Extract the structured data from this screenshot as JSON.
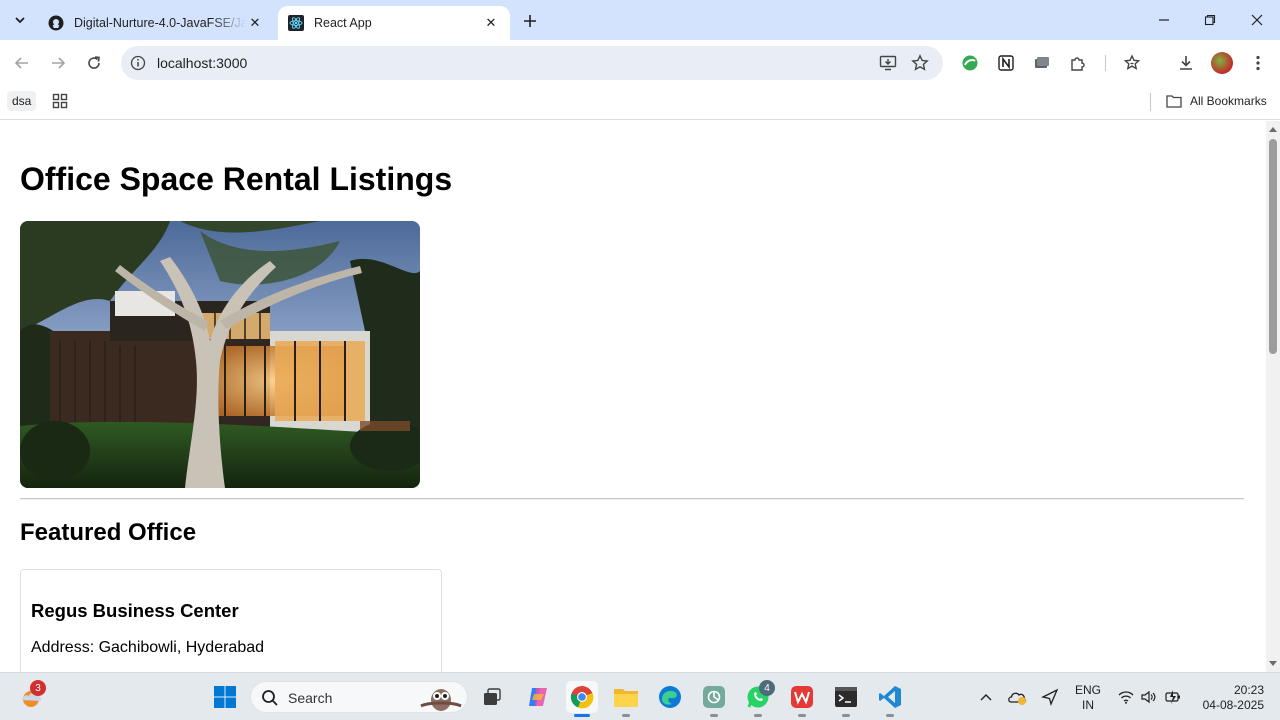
{
  "browser": {
    "tabs": [
      {
        "title": "Digital-Nurture-4.0-JavaFSE/Jav",
        "active": false
      },
      {
        "title": "React App",
        "active": true
      }
    ],
    "address": "localhost:3000",
    "bookmarks": {
      "chip_label": "dsa",
      "all_bookmarks_label": "All Bookmarks"
    }
  },
  "page": {
    "title": "Office Space Rental Listings",
    "featured_heading": "Featured Office",
    "office": {
      "name": "Regus Business Center",
      "address": "Address: Gachibowli, Hyderabad"
    }
  },
  "taskbar": {
    "weather_badge": "3",
    "search_label": "Search",
    "whatsapp_badge": "4",
    "language_line1": "ENG",
    "language_line2": "IN",
    "time": "20:23",
    "date": "04-08-2025"
  },
  "colors": {
    "tabstrip": "#d3e3fd",
    "omnibox": "#e9eef6",
    "taskbar": "#e4e9ee",
    "windows_blue": "#0078d4"
  }
}
